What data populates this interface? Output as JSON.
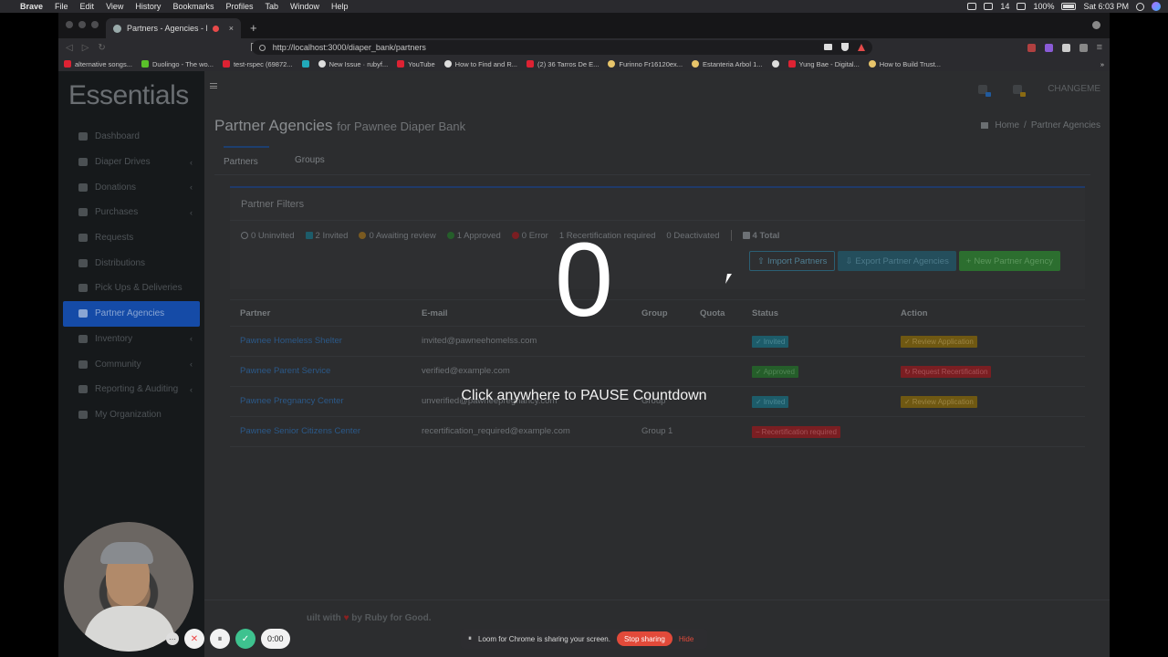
{
  "mac_menu": {
    "app": "Brave",
    "items": [
      "File",
      "Edit",
      "View",
      "History",
      "Bookmarks",
      "Profiles",
      "Tab",
      "Window",
      "Help"
    ],
    "date_num": "14",
    "battery": "100%",
    "clock": "Sat 6:03 PM"
  },
  "browser": {
    "tab_title": "Partners - Agencies - Pawn",
    "url": "http://localhost:3000/diaper_bank/partners",
    "bookmarks": [
      "alternative songs...",
      "Duolingo - The wo...",
      "test-rspec (69872...",
      "",
      "New Issue · rubyf...",
      "YouTube",
      "How to Find and R...",
      "(2) 36 Tarros De E...",
      "Furinno Fr16120ex...",
      "Estanteria Arbol 1...",
      "",
      "Yung Bae - Digital...",
      "How to Build Trust..."
    ]
  },
  "sidebar": {
    "logo": "Essentials",
    "items": [
      {
        "label": "Dashboard",
        "chevron": false
      },
      {
        "label": "Diaper Drives",
        "chevron": true
      },
      {
        "label": "Donations",
        "chevron": true
      },
      {
        "label": "Purchases",
        "chevron": true
      },
      {
        "label": "Requests",
        "chevron": false
      },
      {
        "label": "Distributions",
        "chevron": false
      },
      {
        "label": "Pick Ups & Deliveries",
        "chevron": false
      },
      {
        "label": "Partner Agencies",
        "chevron": false,
        "active": true
      },
      {
        "label": "Inventory",
        "chevron": true
      },
      {
        "label": "Community",
        "chevron": true
      },
      {
        "label": "Reporting & Auditing",
        "chevron": true
      },
      {
        "label": "My Organization",
        "chevron": false
      }
    ]
  },
  "header": {
    "user": "CHANGEME",
    "title": "Partner Agencies",
    "subtitle": "for Pawnee Diaper Bank",
    "crumb_home": "Home",
    "crumb_sep": "/",
    "crumb_current": "Partner Agencies"
  },
  "tabs": {
    "partners": "Partners",
    "groups": "Groups"
  },
  "filters": {
    "title": "Partner Filters",
    "uninvited": "0 Uninvited",
    "invited": "2 Invited",
    "awaiting": "0 Awaiting review",
    "approved": "1 Approved",
    "error": "0 Error",
    "recert": "1 Recertification required",
    "deactivated": "0 Deactivated",
    "total": "4 Total",
    "import_btn": "Import Partners",
    "export_btn": "Export Partner Agencies",
    "new_btn": "New Partner Agency"
  },
  "table": {
    "headers": {
      "partner": "Partner",
      "email": "E-mail",
      "group": "Group",
      "quota": "Quota",
      "status": "Status",
      "action": "Action"
    },
    "rows": [
      {
        "partner": "Pawnee Homeless Shelter",
        "email": "invited@pawneehomelss.com",
        "group": "",
        "status": "Invited",
        "action": "Review Application"
      },
      {
        "partner": "Pawnee Parent Service",
        "email": "verified@example.com",
        "group": "",
        "status": "Approved",
        "action": "Request Recertification"
      },
      {
        "partner": "Pawnee Pregnancy Center",
        "email": "unverified@pawneepregnancy.com",
        "group": "Group",
        "status": "Invited",
        "action": "Review Application"
      },
      {
        "partner": "Pawnee Senior Citizens Center",
        "email": "recertification_required@example.com",
        "group": "Group 1",
        "status": "Recertification required",
        "action": ""
      }
    ]
  },
  "footer": {
    "pre": "uilt with",
    "post": "by Ruby for Good."
  },
  "overlay": {
    "count": "0",
    "message": "Click anywhere to PAUSE Countdown"
  },
  "loom": {
    "time": "0:00",
    "share_text": "Loom for Chrome is sharing your screen.",
    "stop": "Stop sharing",
    "hide": "Hide"
  },
  "colors": {
    "active_nav": "#154ba7",
    "invited": "#1d5c6a",
    "approved": "#255e2a",
    "recert": "#7a1e22",
    "review": "#6f5812",
    "stop": "#e24a3a"
  }
}
